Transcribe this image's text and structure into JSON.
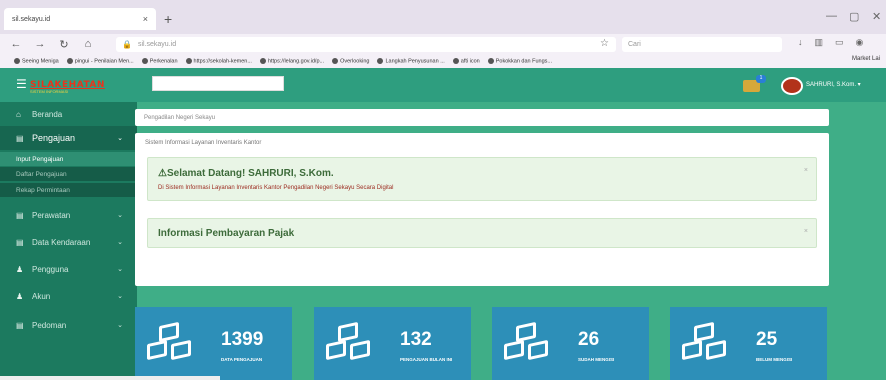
{
  "browser": {
    "tab_title": "sil.sekayu.id",
    "tab_close": "×",
    "new_tab": "+",
    "url": "sil.sekayu.id",
    "search_placeholder": "Cari",
    "bookmarks": [
      "Seeing Meniga",
      "pingui - Penilaian Men...",
      "Perkenalan",
      "https://sekolah-kemen...",
      "https://lelang.gov.id/p...",
      "Overlooking",
      "Langkah Penyusunan ...",
      "afti icon",
      "Pokokkan dan Fungs..."
    ],
    "bookmarks_right": "Market Lai"
  },
  "header": {
    "logo_text": "SILAKEHATAN",
    "logo_subtitle": "SISTEM INFORMASI",
    "user_name": "SAHRURI, S.Kom. ▾",
    "inbox_badge": "1"
  },
  "sidebar": {
    "items": [
      {
        "label": "Beranda",
        "icon": "home-icon"
      },
      {
        "label": "Pengajuan",
        "icon": "table-icon"
      },
      {
        "label": "Perawatan",
        "icon": "table-icon"
      },
      {
        "label": "Data Kendaraan",
        "icon": "table-icon"
      },
      {
        "label": "Pengguna",
        "icon": "user-icon"
      },
      {
        "label": "Akun",
        "icon": "user-icon"
      },
      {
        "label": "Pedoman",
        "icon": "table-icon"
      }
    ],
    "sub_items": [
      "Input Pengajuan",
      "Daftar Pengajuan",
      "Rekap Permintaan"
    ]
  },
  "main": {
    "breadcrumb": "Pengadilan Negeri Sekayu",
    "subtitle": "Sistem Informasi Layanan Inventaris Kantor",
    "welcome_title": "Selamat Datang! SAHRURI, S.Kom.",
    "welcome_text": "Di Sistem Informasi Layanan Inventaris Kantor Pengadilan Negeri Sekayu Secara Digital",
    "tax_title": "Informasi Pembayaran Pajak",
    "close": "×"
  },
  "tiles": [
    {
      "value": "1399",
      "label": "DATA PENGAJUAN"
    },
    {
      "value": "132",
      "label": "PENGAJUAN BULAN INI"
    },
    {
      "value": "26",
      "label": "SUDAH MENGISI"
    },
    {
      "value": "25",
      "label": "BELUM MENGISI"
    }
  ],
  "colors": {
    "header": "#2e9e7f",
    "sidebar": "#1c7a5f",
    "main_bg": "#3fae87",
    "tile": "#2d8fb8"
  }
}
